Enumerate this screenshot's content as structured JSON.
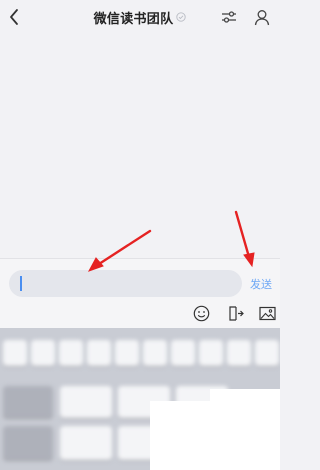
{
  "header": {
    "title": "微信读书团队",
    "back_icon": "chevron-left-icon",
    "verified_icon": "verified-check-icon",
    "settings_icon": "sliders-icon",
    "profile_icon": "person-icon"
  },
  "composer": {
    "input_value": "",
    "send_label": "发送",
    "send_color": "#6fa8f5",
    "tools": [
      "emoji-icon",
      "export-icon",
      "image-icon"
    ]
  },
  "annotations": {
    "arrow_color": "#e52222"
  },
  "colors": {
    "background": "#f2f2f5",
    "input_bg": "#e4e6ec",
    "caret": "#4a8ef0"
  }
}
